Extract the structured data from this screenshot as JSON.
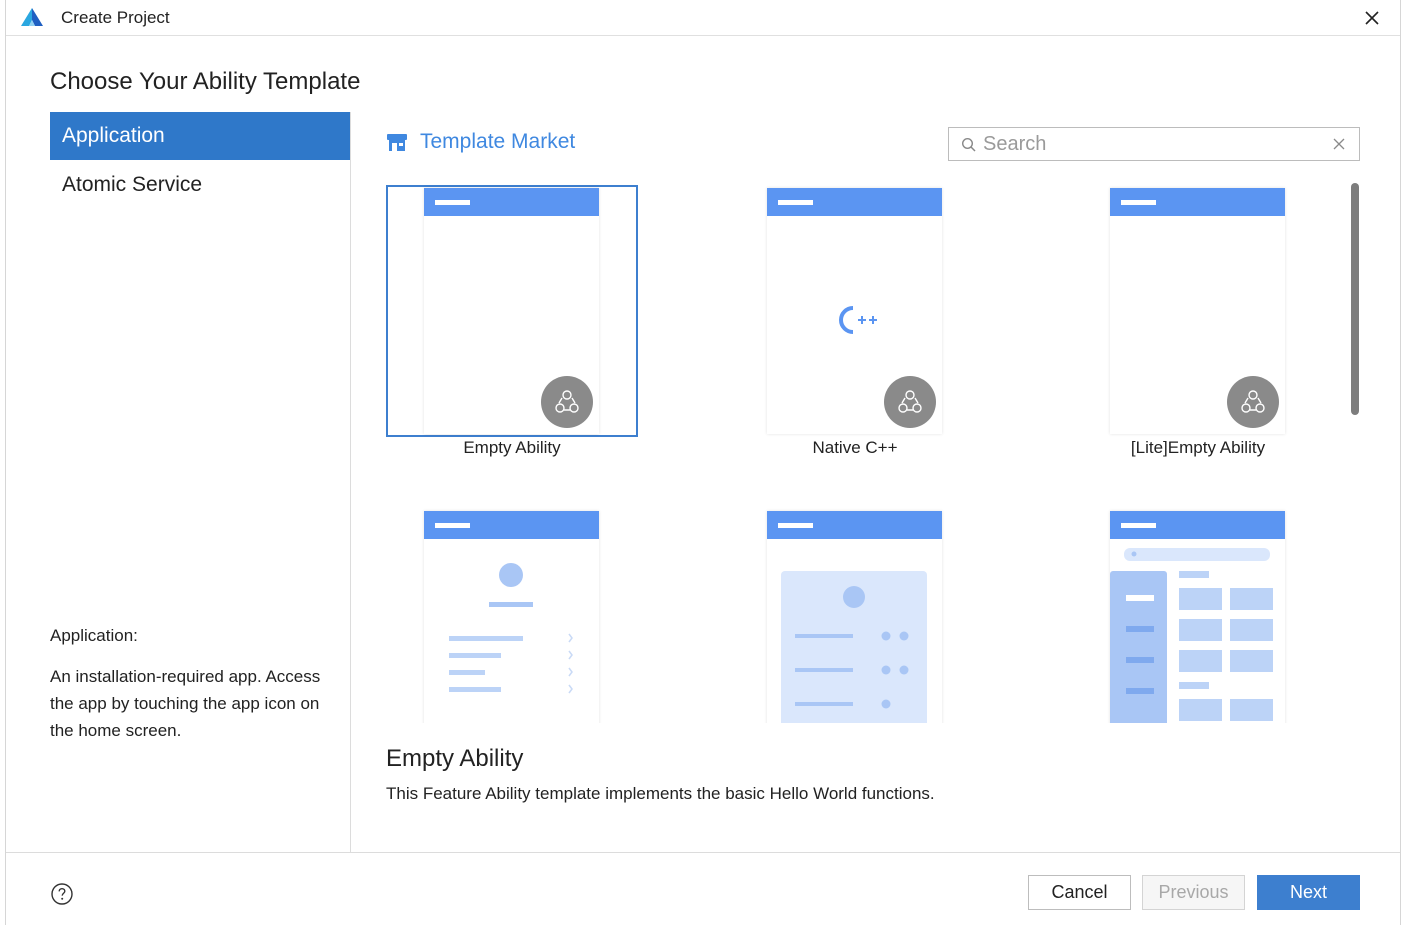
{
  "window": {
    "title": "Create Project"
  },
  "heading": "Choose Your Ability Template",
  "sidebar": {
    "items": [
      {
        "label": "Application",
        "active": true
      },
      {
        "label": "Atomic Service",
        "active": false
      }
    ],
    "description_title": "Application:",
    "description": "An installation-required app. Access the app by touching the app icon on the home screen."
  },
  "market": {
    "label": "Template Market"
  },
  "search": {
    "placeholder": "Search",
    "value": ""
  },
  "templates": [
    {
      "label": "Empty Ability",
      "selected": true
    },
    {
      "label": "Native C++",
      "selected": false
    },
    {
      "label": "[Lite]Empty Ability",
      "selected": false
    }
  ],
  "selected_template": {
    "title": "Empty Ability",
    "description": "This Feature Ability template implements the basic Hello World functions."
  },
  "footer": {
    "cancel": "Cancel",
    "previous": "Previous",
    "next": "Next"
  },
  "icons": {
    "accent": "#2f78c9",
    "template_header": "#5b95f2",
    "badge": "#8a8a8a"
  }
}
